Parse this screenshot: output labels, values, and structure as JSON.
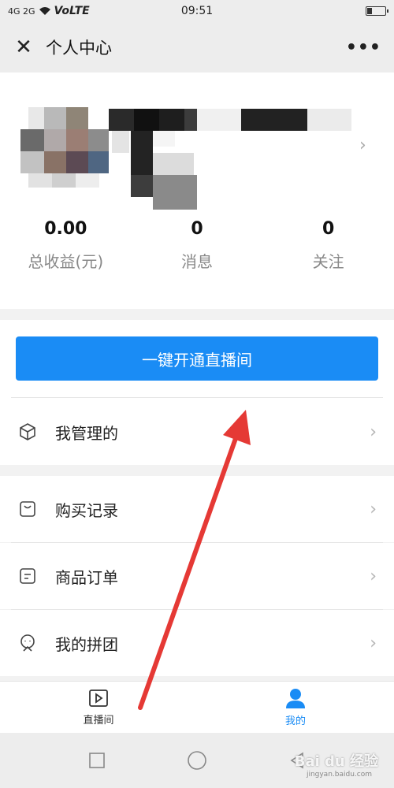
{
  "status": {
    "signal": "4G 2G",
    "network": "VoLTE",
    "time": "09:51"
  },
  "nav": {
    "close_icon": "close-icon",
    "title": "个人中心",
    "more": "•••"
  },
  "stats": [
    {
      "value": "0.00",
      "label": "总收益(元)"
    },
    {
      "value": "0",
      "label": "消息"
    },
    {
      "value": "0",
      "label": "关注"
    }
  ],
  "action": {
    "label": "一键开通直播间"
  },
  "menu": {
    "manage": "我管理的",
    "purchases": "购买记录",
    "orders": "商品订单",
    "group": "我的拼团"
  },
  "tabs": [
    {
      "label": "直播间",
      "icon": "play-box-icon"
    },
    {
      "label": "我的",
      "icon": "person-icon"
    }
  ],
  "watermark": {
    "text": "Bai du 经验",
    "sub": "jingyan.baidu.com"
  },
  "colors": {
    "accent": "#1a8cf5",
    "arrow": "#e53935"
  }
}
